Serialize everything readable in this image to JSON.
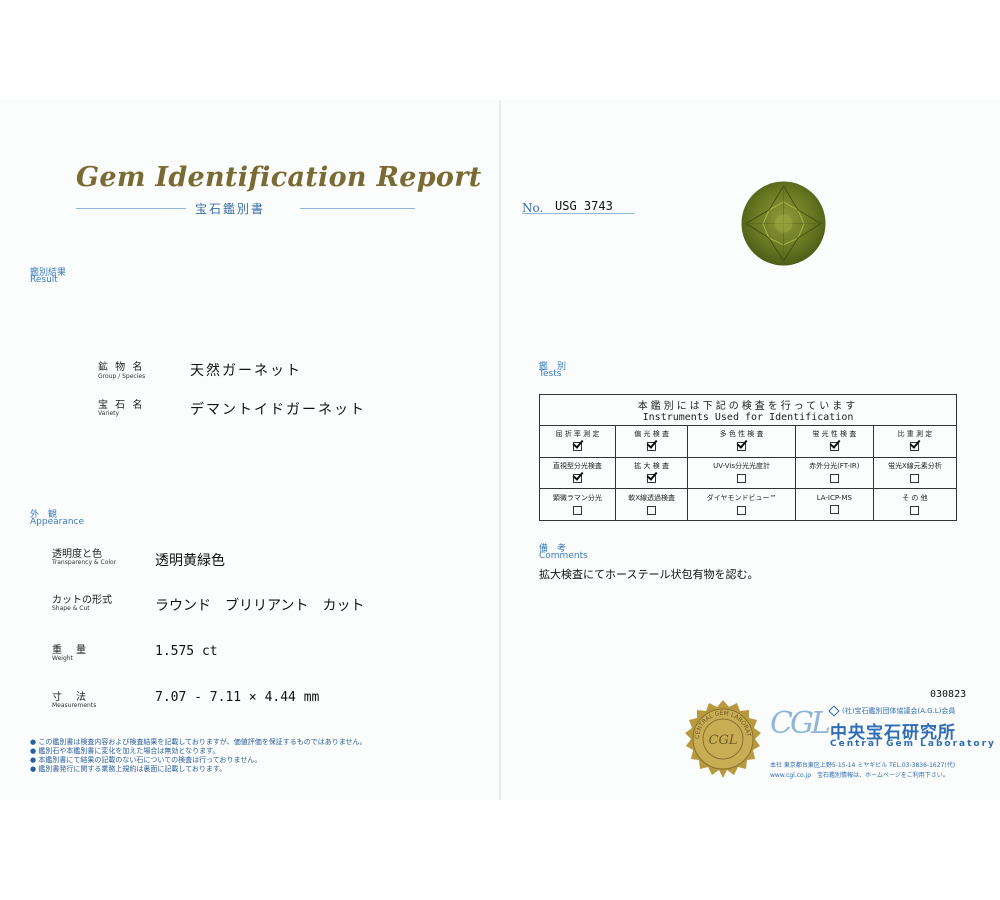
{
  "report": {
    "title": "Gem Identification Report",
    "subtitle": "宝石鑑別書"
  },
  "result": {
    "heading_jp": "鑑別結果",
    "heading_en": "Result",
    "rows": [
      {
        "label_jp": "鉱 物 名",
        "label_en": "Group / Species",
        "value": "天然ガーネット"
      },
      {
        "label_jp": "宝 石 名",
        "label_en": "Variety",
        "value": "デマントイドガーネット"
      }
    ]
  },
  "appearance": {
    "heading_jp": "外　観",
    "heading_en": "Appearance",
    "rows": [
      {
        "label_jp": "透明度と色",
        "label_en": "Transparency & Color",
        "value": "透明黄緑色"
      },
      {
        "label_jp": "カットの形式",
        "label_en": "Shape & Cut",
        "value": "ラウンド　ブリリアント　カット"
      },
      {
        "label_jp": "重　量",
        "label_en": "Weight",
        "value": "1.575 ct"
      },
      {
        "label_jp": "寸　法",
        "label_en": "Measurements",
        "value": "7.07 - 7.11 × 4.44 mm"
      }
    ]
  },
  "notes": [
    "● この鑑別書は検査内容および検査結果を記載しておりますが、価値評価を保証するものではありません。",
    "● 鑑別石や本鑑別書に変化を加えた場合は無効となります。",
    "● 本鑑別書にて結果の記載のない石についての検査は行っておりません。",
    "● 鑑別書発行に関する業務上規約は裏面に記載しております。"
  ],
  "number": {
    "label": "No.",
    "value": "USG 3743"
  },
  "tests": {
    "heading_jp": "鑑　別",
    "heading_en": "Tests",
    "table_title_jp": "本鑑別には下記の検査を行っています",
    "table_title_en": "Instruments Used for Identification",
    "rows": [
      [
        {
          "name": "屈 折 率 測 定",
          "checked": true
        },
        {
          "name": "偏 光 検 査",
          "checked": true
        },
        {
          "name": "多 色 性 検 査",
          "checked": true
        },
        {
          "name": "蛍 光 性 検 査",
          "checked": true
        },
        {
          "name": "比 重 測 定",
          "checked": true
        }
      ],
      [
        {
          "name": "直視型分光検査",
          "checked": true
        },
        {
          "name": "拡 大 検 査",
          "checked": true
        },
        {
          "name": "UV-Vis分光光度計",
          "checked": false
        },
        {
          "name": "赤外分光(FT-IR)",
          "checked": false
        },
        {
          "name": "蛍光X線元素分析",
          "checked": false
        }
      ],
      [
        {
          "name": "顕微ラマン分光",
          "checked": false
        },
        {
          "name": "軟X線透過検査",
          "checked": false
        },
        {
          "name": "ダイヤモンドビュー™",
          "checked": false
        },
        {
          "name": "LA-ICP-MS",
          "checked": false
        },
        {
          "name": "そ の 他",
          "checked": false
        }
      ]
    ]
  },
  "comments": {
    "heading_jp": "備　考",
    "heading_en": "Comments",
    "text": "拡大検査にてホーステール状包有物を認む。"
  },
  "code": "030823",
  "lab": {
    "seal_text": "CENTRAL GEM LABORATORY",
    "seal_mark": "CGL",
    "logo_mark": "CGL",
    "member_line": "(社)宝石鑑別団体協議会(A.G.L)会員",
    "name_jp": "中央宝石研究所",
    "name_en": "Central Gem Laboratory",
    "address": "本社 東京都台東区上野5-15-14 ミヤギビル TEL.03-3836-1627(代)",
    "web": "www.cgl.co.jp　宝石鑑別情報は、ホームページをご利用下さい。"
  },
  "colors": {
    "gem": "#6b7a22",
    "accent_blue": "#3a7bc0",
    "title_gold": "#7a6a33",
    "seal_gold": "#b89a3e"
  }
}
